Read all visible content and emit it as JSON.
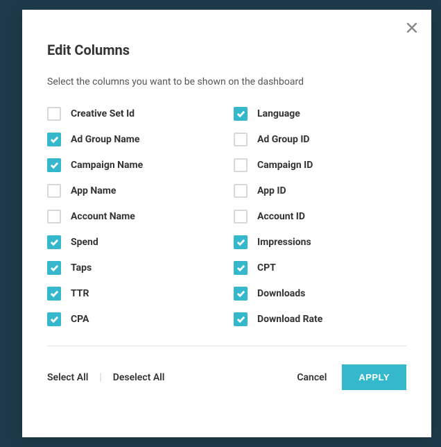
{
  "modal": {
    "title": "Edit Columns",
    "subtitle": "Select the columns you want to be shown on the dashboard",
    "columns": [
      {
        "label": "Creative Set Id",
        "checked": false
      },
      {
        "label": "Language",
        "checked": true
      },
      {
        "label": "Ad Group Name",
        "checked": true
      },
      {
        "label": "Ad Group ID",
        "checked": false
      },
      {
        "label": "Campaign Name",
        "checked": true
      },
      {
        "label": "Campaign ID",
        "checked": false
      },
      {
        "label": "App Name",
        "checked": false
      },
      {
        "label": "App ID",
        "checked": false
      },
      {
        "label": "Account Name",
        "checked": false
      },
      {
        "label": "Account ID",
        "checked": false
      },
      {
        "label": "Spend",
        "checked": true
      },
      {
        "label": "Impressions",
        "checked": true
      },
      {
        "label": "Taps",
        "checked": true
      },
      {
        "label": "CPT",
        "checked": true
      },
      {
        "label": "TTR",
        "checked": true
      },
      {
        "label": "Downloads",
        "checked": true
      },
      {
        "label": "CPA",
        "checked": true
      },
      {
        "label": "Download Rate",
        "checked": true
      }
    ],
    "footer": {
      "select_all": "Select All",
      "deselect_all": "Deselect All",
      "cancel": "Cancel",
      "apply": "APPLY"
    }
  }
}
